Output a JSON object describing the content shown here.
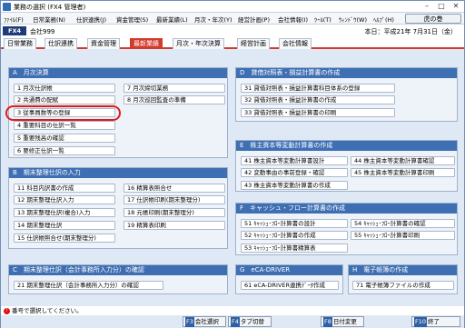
{
  "window": {
    "title": "業務の選択 (FX4 管理者)"
  },
  "menu": {
    "items": [
      "ﾌｧｲﾙ(F)",
      "日常業務(N)",
      "仕訳連携(J)",
      "資金管理(S)",
      "最新業績(L)",
      "月次・年次(Y)",
      "経営計画(P)",
      "会社情報(I)",
      "ﾂｰﾙ(T)",
      "ｳｨﾝﾄﾞｳ(W)",
      "ﾍﾙﾌﾟ(H)"
    ],
    "tora_button": "虎の巻"
  },
  "info": {
    "logo": "FX4",
    "company": "会社999",
    "date": "本日：平成21年 7月31日（金）"
  },
  "tabs": [
    "日常業務",
    "仕訳連携",
    "資金管理",
    "最新業績",
    "月次・年次決算",
    "経営計画",
    "会社情報"
  ],
  "sections": {
    "A": {
      "title": "A　月次決算",
      "items": [
        "1 月次仕訳帳",
        "2 共通費の配賦",
        "3 従事員数等の登録",
        "4 重要科目の仕訳一覧",
        "5 重要残高の確認",
        "6 要修正仕訳一覧",
        "7 月次締切業務",
        "8 月次巡回監査の準備"
      ]
    },
    "D": {
      "title": "D　貸借対照表・損益計算書の作成",
      "items": [
        "31 貸借対照表・損益計算書科目体系の登録",
        "32 貸借対照表・損益計算書の作成",
        "33 貸借対照表・損益計算書の印刷"
      ]
    },
    "E": {
      "title": "E　株主資本等変動計算書の作成",
      "items": [
        "41 株主資本等変動計算書設計",
        "42 変動事由の事前登録・確認",
        "43 株主資本等変動計算書の作成",
        "44 株主資本等変動計算書確認",
        "45 株主資本等変動計算書印刷"
      ]
    },
    "B": {
      "title": "B　期末整理仕訳の入力",
      "items": [
        "11 科目内訳書の作成",
        "12 期末整理仕訳入力",
        "13 期末整理仕訳(複合)入力",
        "14 期末整理仕訳",
        "15 仕訳帳照合せ(期末整理分)",
        "16 精算表照合せ",
        "17 仕訳帳印刷(期末整理分)",
        "18 元帳印刷(期末整理分)",
        "19 精算表印刷"
      ]
    },
    "F": {
      "title": "F　キャッシュ・フロー計算書の作成",
      "items": [
        "51 ｷｬｯｼｭ･ﾌﾛｰ計算書の設計",
        "52 ｷｬｯｼｭ･ﾌﾛｰ計算書の作成",
        "53 ｷｬｯｼｭ･ﾌﾛｰ計算書精算表",
        "54 ｷｬｯｼｭ･ﾌﾛｰ計算書の確認",
        "55 ｷｬｯｼｭ･ﾌﾛｰ計算書印刷"
      ]
    },
    "C": {
      "title": "C　期末整理仕訳（会計事務所入力分）の確認",
      "items": [
        "21 期末整理仕訳（会計事務所入力分）の確認"
      ]
    },
    "G": {
      "title": "G　eCA-DRIVER",
      "items": [
        "61 eCA-DRIVER連携ﾃﾞｰﾀ作成"
      ]
    },
    "H": {
      "title": "H　電子帳簿の作成",
      "items": [
        "71 電子帳簿ファイルの作成"
      ]
    }
  },
  "status": {
    "message": "番号で選択してください。",
    "warn_glyph": "!"
  },
  "fkeys": [
    {
      "key": "F3",
      "label": "会社選択"
    },
    {
      "key": "F4",
      "label": "タブ切替"
    },
    {
      "key": "F8",
      "label": "日付変更"
    },
    {
      "key": "F10",
      "label": "終了"
    }
  ]
}
